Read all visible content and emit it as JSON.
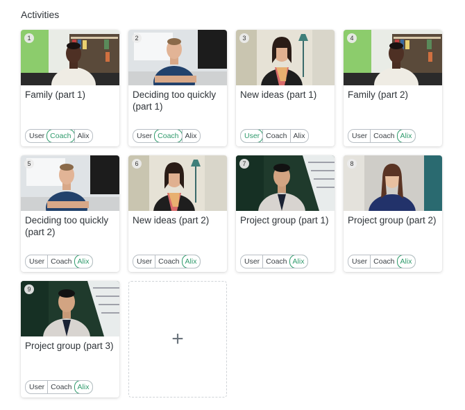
{
  "heading": "Activities",
  "add_icon": "plus-icon",
  "accent_color": "#2e9a6b",
  "activities": [
    {
      "num": "1",
      "title": "Family (part 1)",
      "roles": [
        "User",
        "Coach",
        "Alix"
      ],
      "active": 1,
      "scene": "man-bookshelf"
    },
    {
      "num": "2",
      "title": "Deciding too quickly (part 1)",
      "roles": [
        "User",
        "Coach",
        "Alix"
      ],
      "active": 1,
      "scene": "man-office"
    },
    {
      "num": "3",
      "title": "New ideas (part 1)",
      "roles": [
        "User",
        "Coach",
        "Alix"
      ],
      "active": 0,
      "scene": "woman-lamp"
    },
    {
      "num": "4",
      "title": "Family (part 2)",
      "roles": [
        "User",
        "Coach",
        "Alix"
      ],
      "active": 2,
      "scene": "man-bookshelf"
    },
    {
      "num": "5",
      "title": "Deciding too quickly (part 2)",
      "roles": [
        "User",
        "Coach",
        "Alix"
      ],
      "active": 2,
      "scene": "man-office"
    },
    {
      "num": "6",
      "title": "New ideas (part 2)",
      "roles": [
        "User",
        "Coach",
        "Alix"
      ],
      "active": 2,
      "scene": "woman-lamp"
    },
    {
      "num": "7",
      "title": "Project group (part 1)",
      "roles": [
        "User",
        "Coach",
        "Alix"
      ],
      "active": 2,
      "scene": "man-stairs"
    },
    {
      "num": "8",
      "title": "Project group (part 2)",
      "roles": [
        "User",
        "Coach",
        "Alix"
      ],
      "active": 2,
      "scene": "woman-blue"
    },
    {
      "num": "9",
      "title": "Project group (part 3)",
      "roles": [
        "User",
        "Coach",
        "Alix"
      ],
      "active": 2,
      "scene": "man-stairs"
    }
  ]
}
